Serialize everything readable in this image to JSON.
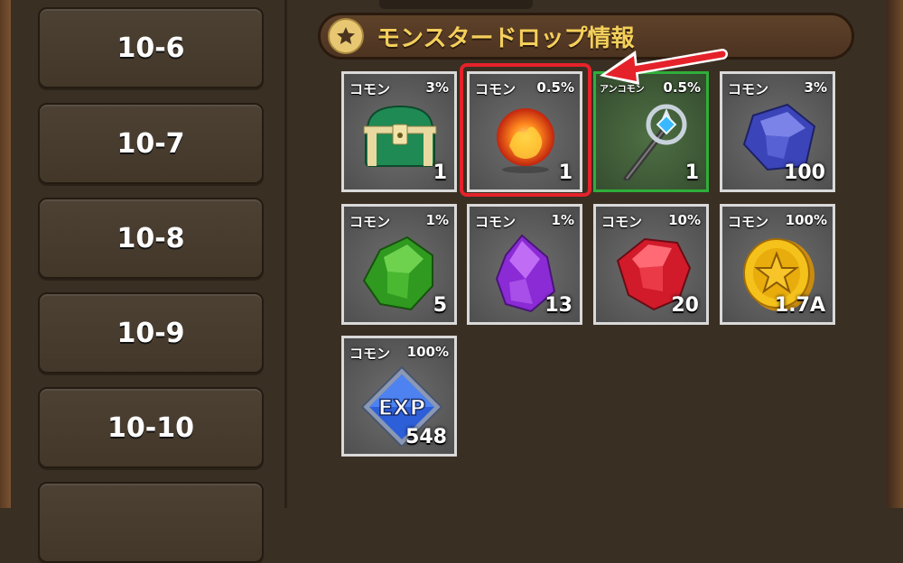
{
  "stages": [
    {
      "label": "10-6"
    },
    {
      "label": "10-7"
    },
    {
      "label": "10-8"
    },
    {
      "label": "10-9"
    },
    {
      "label": "10-10"
    },
    {
      "label": ""
    }
  ],
  "header": {
    "title": "モンスタードロップ情報",
    "icon": "star-icon"
  },
  "items": [
    {
      "name": "chest",
      "icon": "treasure-chest-icon",
      "rarity": "コモン",
      "rate": "3%",
      "qty": "1"
    },
    {
      "name": "fire-orb",
      "icon": "fire-orb-icon",
      "rarity": "コモン",
      "rate": "0.5%",
      "qty": "1"
    },
    {
      "name": "staff",
      "icon": "staff-icon",
      "rarity": "アンコモン",
      "rate": "0.5%",
      "qty": "1"
    },
    {
      "name": "blue-gem",
      "icon": "blue-gem-icon",
      "rarity": "コモン",
      "rate": "3%",
      "qty": "100"
    },
    {
      "name": "green-gem",
      "icon": "green-gem-icon",
      "rarity": "コモン",
      "rate": "1%",
      "qty": "5"
    },
    {
      "name": "purple-crystal",
      "icon": "purple-crystal-icon",
      "rarity": "コモン",
      "rate": "1%",
      "qty": "13"
    },
    {
      "name": "red-gem",
      "icon": "red-gem-icon",
      "rarity": "コモン",
      "rate": "10%",
      "qty": "20"
    },
    {
      "name": "gold-coin",
      "icon": "gold-coin-icon",
      "rarity": "コモン",
      "rate": "100%",
      "qty": "1.7A"
    },
    {
      "name": "exp",
      "icon": "exp-badge-icon",
      "rarity": "コモン",
      "rate": "100%",
      "qty": "548",
      "badge_text": "EXP"
    }
  ],
  "colors": {
    "header_text": "#f4cf5b",
    "highlight": "#e5222a",
    "uncommon_border": "#2fae3a",
    "common_border": "#d9d9d9"
  }
}
